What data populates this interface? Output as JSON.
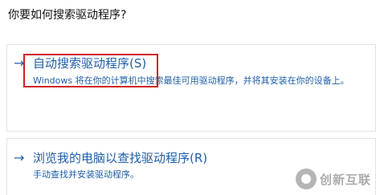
{
  "dialog": {
    "question": "你要如何搜索驱动程序?"
  },
  "options": [
    {
      "arrow": "→",
      "title": "自动搜索驱动程序(S)",
      "description": "Windows 将在你的计算机中搜索最佳可用驱动程序，并将其安装在你的设备上。"
    },
    {
      "arrow": "→",
      "title": "浏览我的电脑以查找驱动程序(R)",
      "description": "手动查找并安装驱动程序。"
    }
  ],
  "watermark": {
    "text": "创新互联"
  },
  "colors": {
    "link_blue": "#1f5fa8",
    "highlight_red": "#d02020"
  }
}
